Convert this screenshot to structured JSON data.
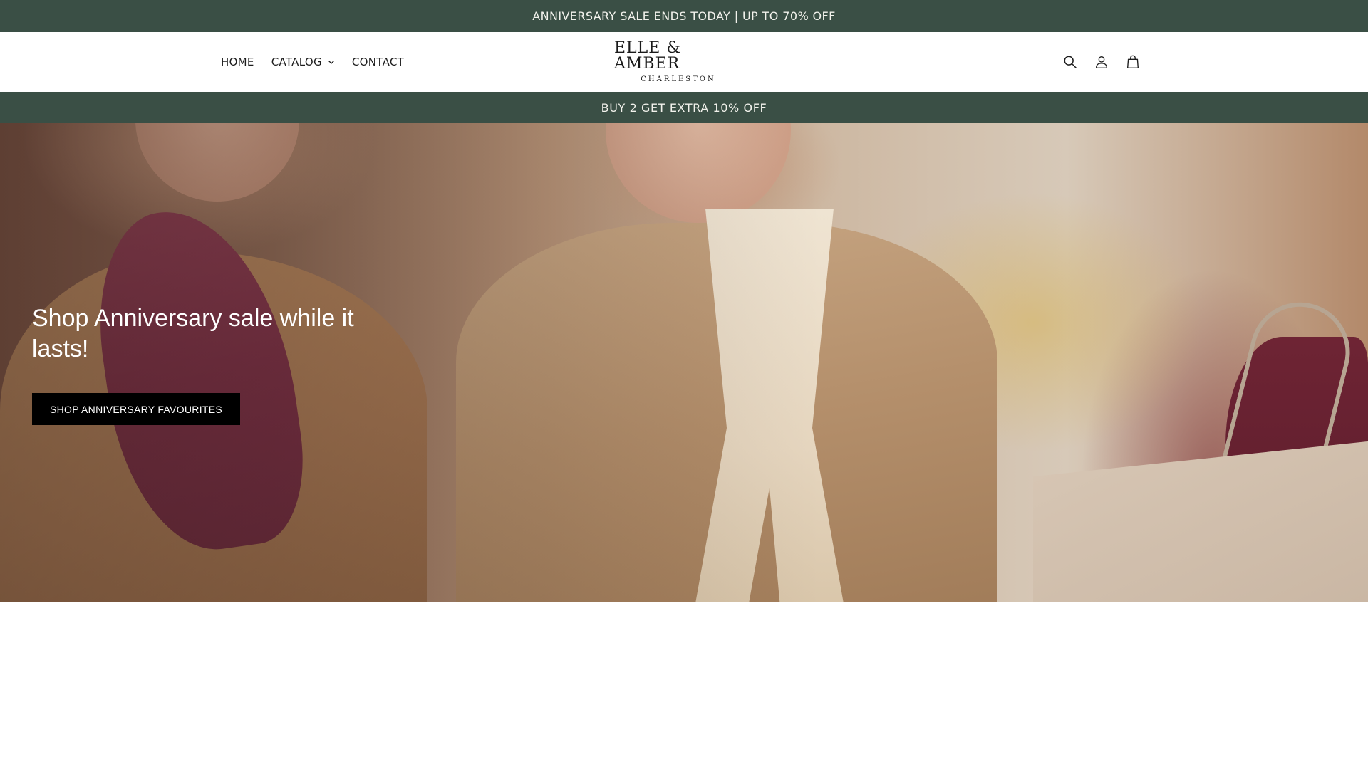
{
  "announcement_top": {
    "text": "ANNIVERSARY SALE ENDS TODAY | UP TO 70% OFF"
  },
  "header": {
    "nav": [
      {
        "label": "HOME"
      },
      {
        "label": "CATALOG"
      },
      {
        "label": "CONTACT"
      }
    ],
    "logo": {
      "main": "ELLE & AMBER",
      "sub": "CHARLESTON"
    },
    "icons": [
      "search-icon",
      "account-icon",
      "cart-icon"
    ]
  },
  "announcement_promo": {
    "text": "BUY 2 GET EXTRA 10% OFF"
  },
  "hero": {
    "title": "Shop Anniversary sale while it lasts!",
    "button_label": "SHOP ANNIVERSARY FAVOURITES"
  },
  "colors": {
    "announcement_bg": "#3a4f45",
    "button_bg": "#000000"
  }
}
